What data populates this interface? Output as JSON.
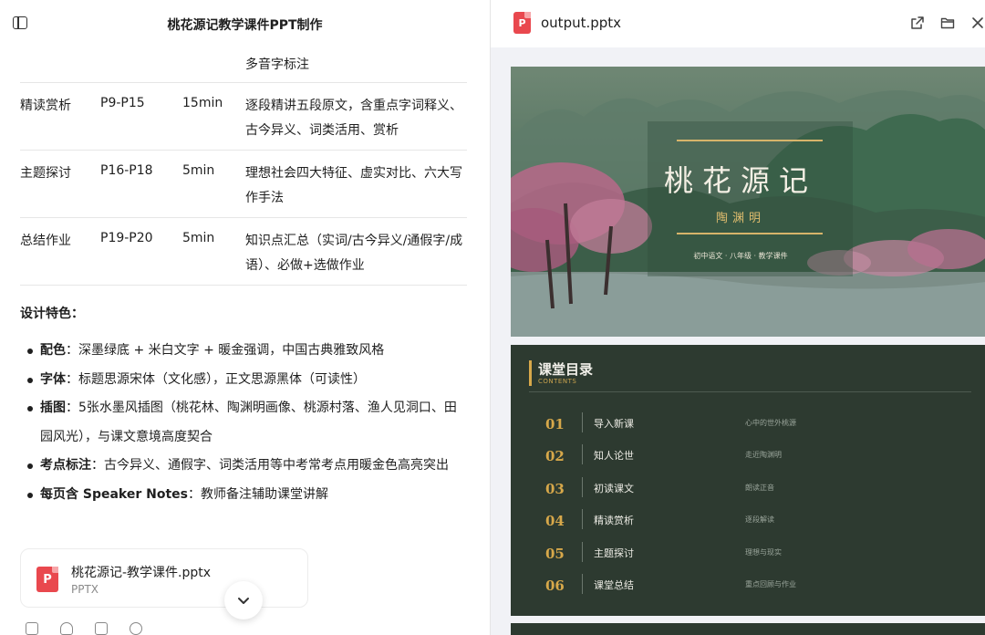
{
  "chat": {
    "title": "桃花源记教学课件PPT制作",
    "table_rows": [
      {
        "section": "",
        "pages": "",
        "time": "",
        "content": "多音字标注"
      },
      {
        "section": "精读赏析",
        "pages": "P9-P15",
        "time": "15min",
        "content": "逐段精讲五段原文，含重点字词释义、古今异义、词类活用、赏析"
      },
      {
        "section": "主题探讨",
        "pages": "P16-P18",
        "time": "5min",
        "content": "理想社会四大特征、虚实对比、六大写作手法"
      },
      {
        "section": "总结作业",
        "pages": "P19-P20",
        "time": "5min",
        "content": "知识点汇总（实词/古今异义/通假字/成语）、必做+选做作业"
      }
    ],
    "design_title": "设计特色：",
    "features": [
      {
        "label": "配色",
        "text": "：深墨绿底 + 米白文字 + 暖金强调，中国古典雅致风格"
      },
      {
        "label": "字体",
        "text": "：标题思源宋体（文化感），正文思源黑体（可读性）"
      },
      {
        "label": "插图",
        "text": "：5张水墨风插图（桃花林、陶渊明画像、桃源村落、渔人见洞口、田园风光），与课文意境高度契合"
      },
      {
        "label": "考点标注",
        "text": "：古今异义、通假字、词类活用等中考常考点用暖金色高亮突出"
      },
      {
        "label": "每页含 Speaker Notes",
        "text": "：教师备注辅助课堂讲解"
      }
    ],
    "file": {
      "name": "桃花源记-教学课件.pptx",
      "type": "PPTX",
      "icon_letter": "P"
    }
  },
  "preview": {
    "file_name": "output.pptx",
    "icon_letter": "P",
    "icons": [
      "open-external-icon",
      "folder-icon",
      "close-icon"
    ],
    "slide1": {
      "title": "桃花源记",
      "author": "陶渊明",
      "subtitle": "初中语文 · 八年级 · 教学课件"
    },
    "slide2": {
      "title": "课堂目录",
      "subtitle": "CONTENTS",
      "items": [
        {
          "num": "01",
          "name": "导入新课",
          "desc": "心中的世外桃源"
        },
        {
          "num": "02",
          "name": "知人论世",
          "desc": "走近陶渊明"
        },
        {
          "num": "03",
          "name": "初读课文",
          "desc": "朗读正音"
        },
        {
          "num": "04",
          "name": "精读赏析",
          "desc": "逐段解读"
        },
        {
          "num": "05",
          "name": "主题探讨",
          "desc": "理想与现实"
        },
        {
          "num": "06",
          "name": "课堂总结",
          "desc": "重点回顾与作业"
        }
      ]
    }
  },
  "colors": {
    "accent_gold": "#d7a84a",
    "slide_bg": "#2d3a30",
    "ppt_red": "#e9484e"
  }
}
